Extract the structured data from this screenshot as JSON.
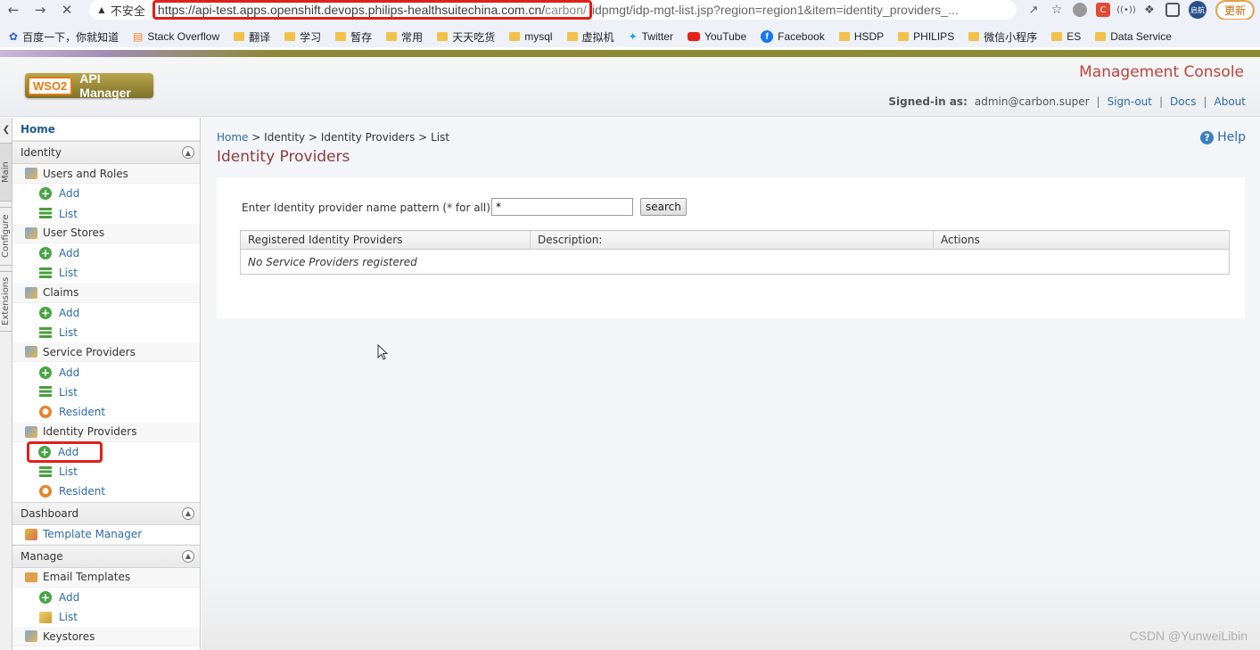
{
  "browser": {
    "insecure_label": "不安全",
    "url_highlighted_main": "https://api-test.apps.openshift.devops.philips-healthsuitechina.com.cn/",
    "url_highlighted_dim": "carbon/",
    "url_rest": "idpmgt/idp-mgt-list.jsp?region=region1&item=identity_providers_...",
    "update_label": "更新",
    "avatar_label": "启航",
    "bookmarks": [
      "百度一下，你就知道",
      "Stack Overflow",
      "翻译",
      "学习",
      "暂存",
      "常用",
      "天天吃货",
      "mysql",
      "虚拟机",
      "Twitter",
      "YouTube",
      "Facebook",
      "HSDP",
      "PHILIPS",
      "微信小程序",
      "ES",
      "Data Service"
    ]
  },
  "header": {
    "logo_wso2": "WSO2",
    "logo_product": "API Manager",
    "console_title": "Management Console",
    "signed_in_label": "Signed-in as:",
    "signed_in_user": "admin@carbon.super",
    "sign_out": "Sign-out",
    "docs": "Docs",
    "about": "About"
  },
  "vtabs": [
    "Main",
    "Configure",
    "Extensions"
  ],
  "sidebar": {
    "home": "Home",
    "identity": {
      "title": "Identity",
      "users_roles": "Users and Roles",
      "user_stores": "User Stores",
      "claims": "Claims",
      "service_providers": "Service Providers",
      "identity_providers": "Identity Providers",
      "add": "Add",
      "list": "List",
      "resident": "Resident"
    },
    "dashboard": {
      "title": "Dashboard",
      "template_manager": "Template Manager"
    },
    "manage": {
      "title": "Manage",
      "email_templates": "Email Templates",
      "add": "Add",
      "list": "List",
      "keystores": "Keystores"
    }
  },
  "main": {
    "breadcrumb": {
      "home": "Home",
      "sep": ">",
      "identity": "Identity",
      "identity_providers": "Identity Providers",
      "list": "List"
    },
    "help": "Help",
    "title": "Identity Providers",
    "search": {
      "label": "Enter Identity provider name pattern (* for all)",
      "value": "*",
      "button": "search"
    },
    "table": {
      "headers": [
        "Registered Identity Providers",
        "Description:",
        "Actions"
      ],
      "empty_message": "No Service Providers registered"
    }
  },
  "watermark": "CSDN @YunweiLibin"
}
